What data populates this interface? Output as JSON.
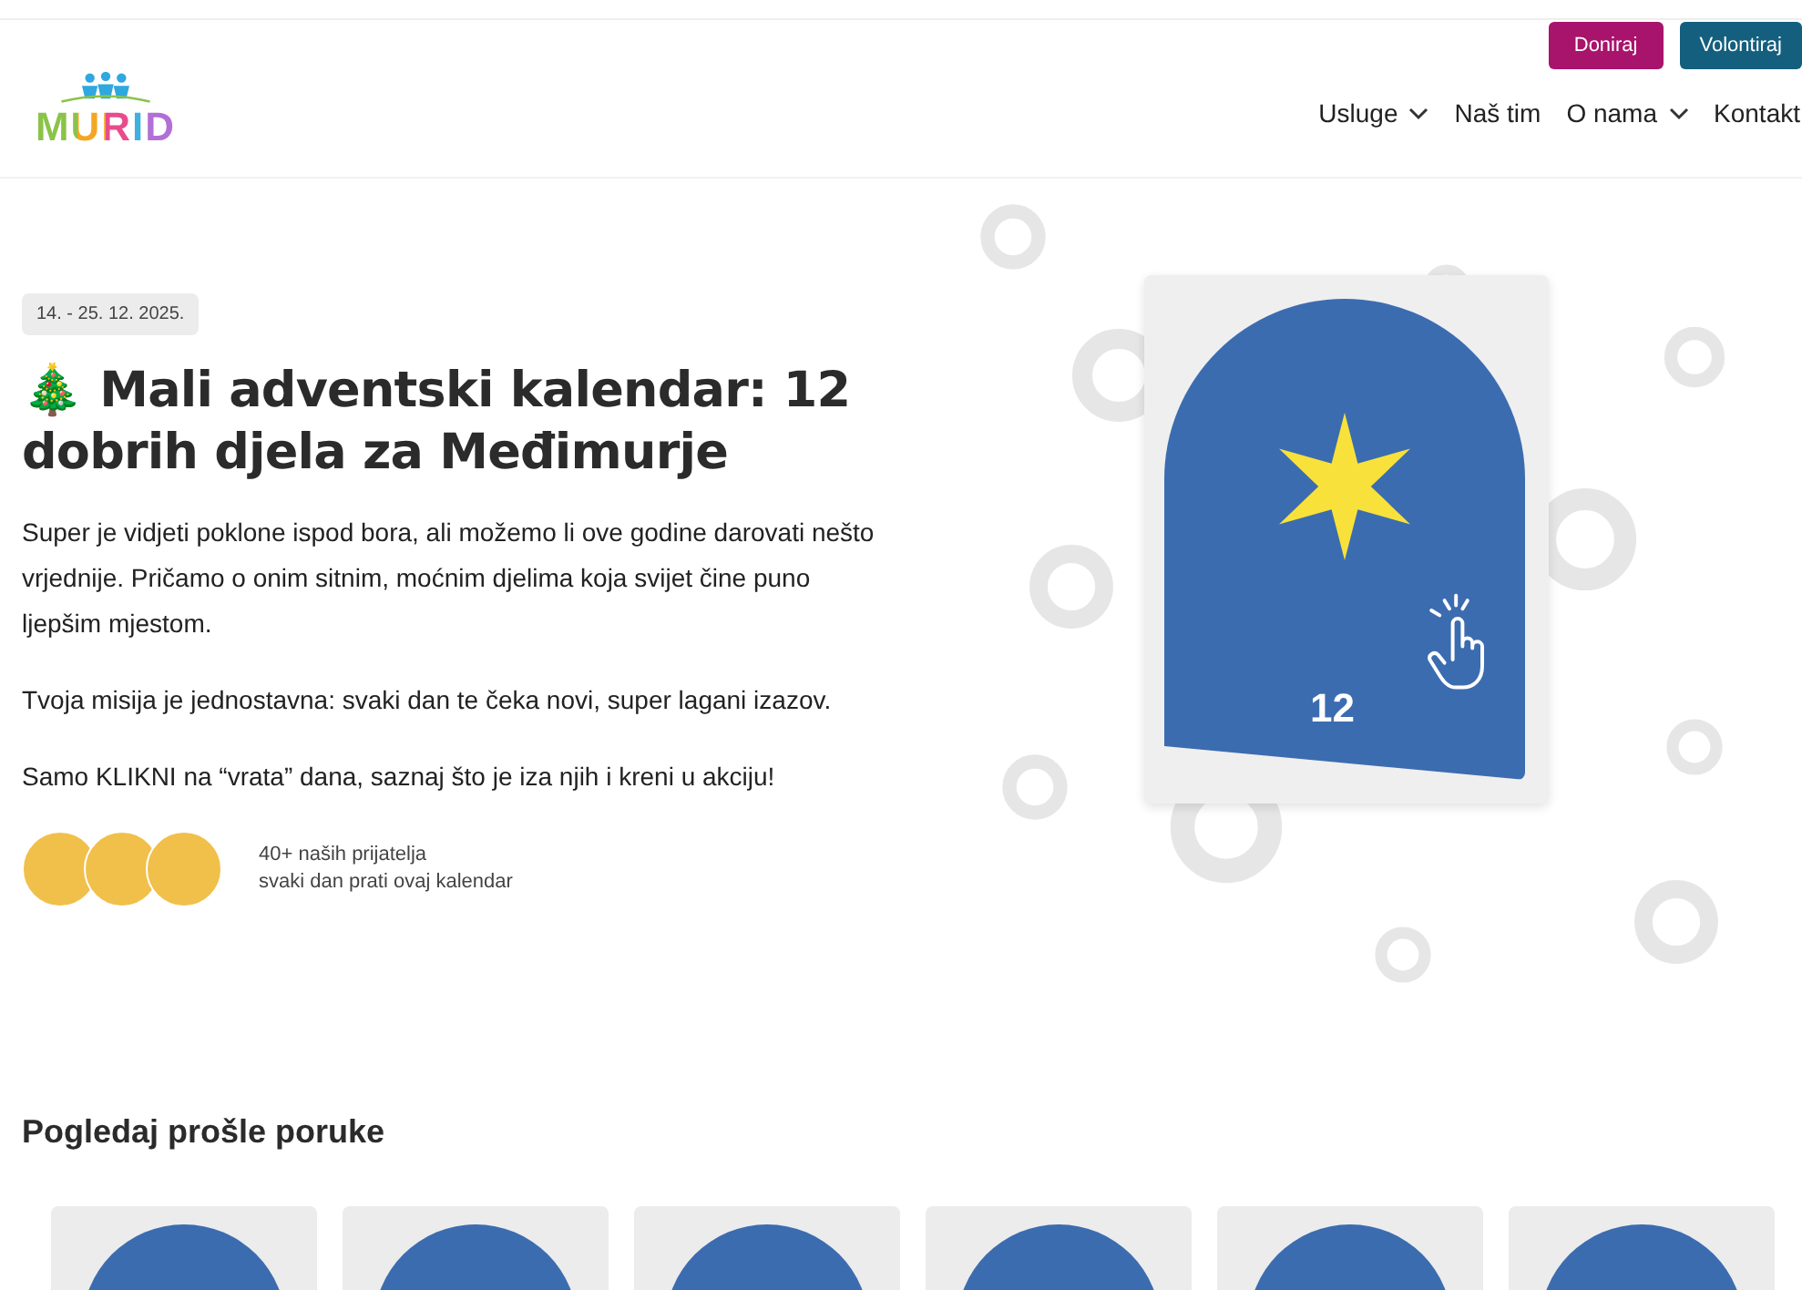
{
  "header": {
    "logo": "MURID",
    "buttons": [
      {
        "label": "Doniraj",
        "kind": "donate"
      },
      {
        "label": "Volontiraj",
        "kind": "volunteer"
      }
    ],
    "nav": [
      {
        "label": "Usluge",
        "dropdown": true
      },
      {
        "label": "Naš tim",
        "dropdown": false
      },
      {
        "label": "O nama",
        "dropdown": true
      },
      {
        "label": "Kontakt",
        "dropdown": false
      }
    ]
  },
  "hero": {
    "date": "14. - 25. 12. 2025.",
    "emoji": "🎄",
    "title": "Mali adventski kalendar: 12 dobrih djela za Međimurje",
    "paragraphs": [
      "Super je vidjeti poklone ispod bora, ali možemo li ove godine darovati nešto vrjednije. Pričamo o onim sitnim, moćnim djelima koja svijet čine puno ljepšim mjestom.",
      "Tvoja misija je jednostavna: svaki dan te čeka novi, super lagani izazov.",
      "Samo KLIKNI na “vrata” dana, saznaj što je iza njih i kreni u akciju!"
    ],
    "avatars": [
      {
        "kind": "photo"
      },
      {
        "kind": "photo"
      },
      {
        "kind": "photo"
      }
    ],
    "followers": [
      "40+ naših prijatelja",
      "svaki dan prati ovaj kalendar"
    ],
    "door": {
      "number": "12"
    }
  },
  "past": {
    "title": "Pogledaj prošle poruke",
    "cards": [
      {
        "kind": "door"
      },
      {
        "kind": "door"
      },
      {
        "kind": "door"
      },
      {
        "kind": "door"
      },
      {
        "kind": "door"
      },
      {
        "kind": "door"
      }
    ]
  }
}
